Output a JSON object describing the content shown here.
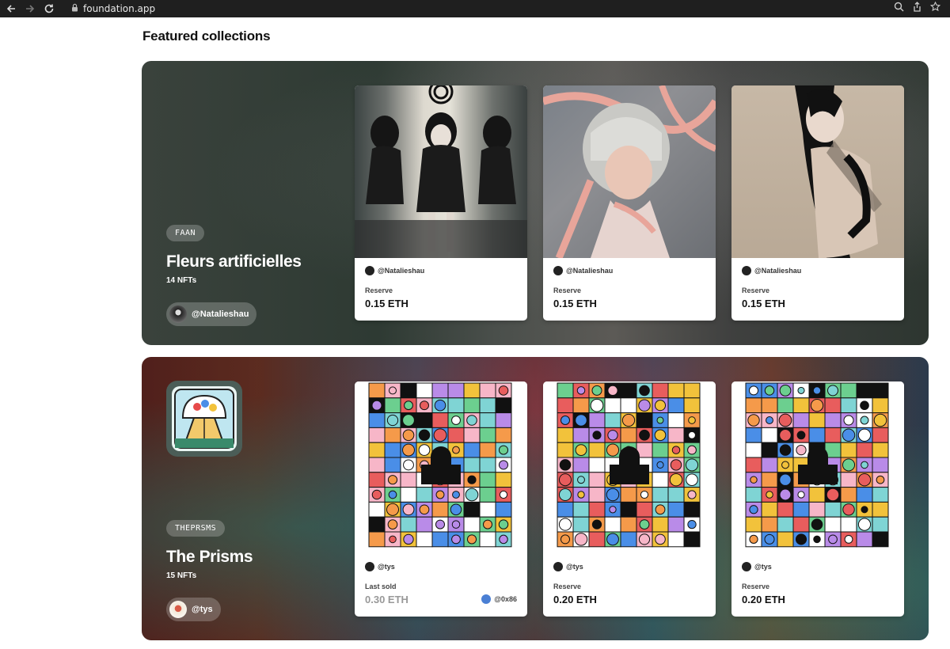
{
  "browser": {
    "url": "foundation.app"
  },
  "page": {
    "heading": "Featured collections"
  },
  "collections": [
    {
      "tag": "FAAN",
      "title": "Fleurs artificielles",
      "count": "14 NFTs",
      "creator": "@Natalieshau",
      "cards": [
        {
          "owner": "@Natalieshau",
          "label": "Reserve",
          "price": "0.15 ETH"
        },
        {
          "owner": "@Natalieshau",
          "label": "Reserve",
          "price": "0.15 ETH"
        },
        {
          "owner": "@Natalieshau",
          "label": "Reserve",
          "price": "0.15 ETH"
        }
      ]
    },
    {
      "tag": "THEPRSMS",
      "title": "The Prisms",
      "count": "15 NFTs",
      "creator": "@tys",
      "cards": [
        {
          "owner": "@tys",
          "label": "Last sold",
          "price": "0.30 ETH",
          "buyer": "@0x86"
        },
        {
          "owner": "@tys",
          "label": "Reserve",
          "price": "0.20 ETH"
        },
        {
          "owner": "@tys",
          "label": "Reserve",
          "price": "0.20 ETH"
        }
      ]
    }
  ]
}
